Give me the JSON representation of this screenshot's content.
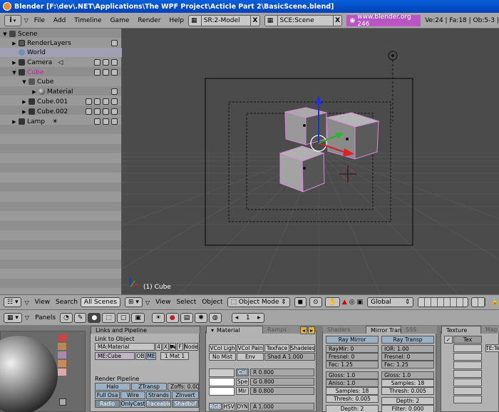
{
  "window": {
    "title": "Blender [F:\\dev\\.NET\\Applications\\The WPF Project\\Acticle Part 2\\BasicScene.blend]"
  },
  "menubar": {
    "menus": [
      "File",
      "Add",
      "Timeline",
      "Game",
      "Render",
      "Help"
    ],
    "screen": "SR:2-Model",
    "scene": "SCE:Scene",
    "site": "www.blender.org 246",
    "stats": "Ve:24 | Fa:18 | Ob:5-3 |",
    "close": "X"
  },
  "outliner": {
    "rows": [
      {
        "label": "Scene",
        "indent": 0
      },
      {
        "label": "RenderLayers",
        "indent": 1
      },
      {
        "label": "World",
        "indent": 1
      },
      {
        "label": "Camera",
        "indent": 1
      },
      {
        "label": "Cube",
        "indent": 1
      },
      {
        "label": "Cube",
        "indent": 2
      },
      {
        "label": "Material",
        "indent": 3
      },
      {
        "label": "Cube.001",
        "indent": 1
      },
      {
        "label": "Cube.002",
        "indent": 1
      },
      {
        "label": "Lamp",
        "indent": 1
      }
    ],
    "header": {
      "view": "View",
      "search": "Search",
      "scenes": "All Scenes"
    }
  },
  "viewport": {
    "object_label": "(1) Cube",
    "header": {
      "view": "View",
      "select": "Select",
      "object": "Object",
      "mode": "Object Mode",
      "orientation": "Global"
    }
  },
  "buttons_header": {
    "panels": "Panels",
    "frame": "1"
  },
  "links_panel": {
    "tab": "Links and Pipeline",
    "link_to_object": "Link to Object",
    "material": "MA:Material",
    "users": "4",
    "x": "X",
    "f": "F",
    "node": "Node",
    "mesh": "ME:Cube",
    "ob": "OB",
    "me": "ME",
    "mat_count": "1 Mat 1",
    "render_pipeline": "Render Pipeline",
    "halo": "Halo",
    "ztransp": "ZTransp",
    "zoffs": "Zoffs: 0.00",
    "full_osa": "Full Osa",
    "wire": "Wire",
    "strands": "Strands",
    "zinvert": "ZInvert",
    "radio": "Radio",
    "onlycast": "OnlyCast",
    "traceable": "Traceable",
    "shadbuf": "Shadbuf"
  },
  "material_panel": {
    "tab_material": "Material",
    "tab_ramps": "Ramps",
    "vcol_light": "VCol Ligh",
    "vcol_paint": "VCol Pain",
    "texface": "TexFace",
    "shadeless": "Shadeles",
    "no_mist": "No Mist",
    "env": "Env",
    "shad_a": "Shad A 1.000",
    "col": "Col",
    "spe": "Spe",
    "mir": "Mir",
    "r": "R 0.800",
    "g": "G 0.800",
    "b": "B 0.800",
    "rgb": "RGB",
    "hsv": "HSV",
    "dyn": "DYN",
    "alpha": "A 1.000"
  },
  "mirror_panel": {
    "tab_shaders": "Shaders",
    "tab_mirror": "Mirror Tran",
    "tab_sss": "SSS",
    "ray_mirror": "Ray Mirror",
    "ray_transp": "Ray Transp",
    "raymir": "RayMir: 0",
    "ior": "IOR: 1.00",
    "fresnel1": "Fresnel: 0",
    "fresnel2": "Fresnel: 0",
    "fac1": "Fac: 1.25",
    "fac2": "Fac: 1.25",
    "gloss1": "Gloss: 1.0",
    "gloss2": "Gloss: 1.0",
    "aniso": "Aniso: 1.0",
    "samples1": "Samples: 18",
    "samples2": "Samples: 18",
    "thresh1": "Thresh: 0.005",
    "thresh2": "Thresh: 0.005",
    "depth1": "Depth: 2",
    "depth2": "Depth: 2",
    "filter": "Filter: 0.000"
  },
  "texture_panel": {
    "tab_texture": "Texture",
    "tab_map": "Map",
    "tex": "Tex",
    "te": "TE:Te"
  }
}
